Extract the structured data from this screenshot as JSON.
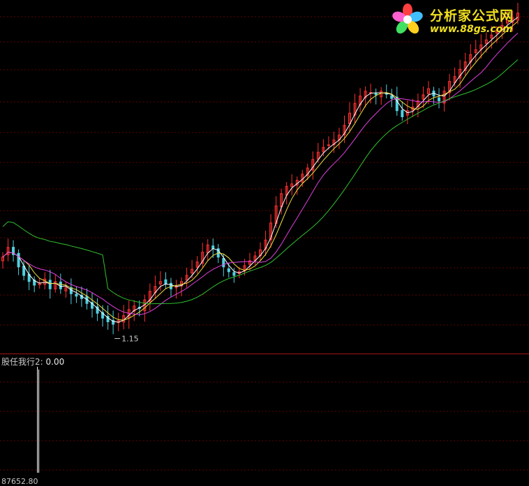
{
  "chart_data": [
    {
      "type": "candlestick",
      "panel": "main",
      "min_marker": "1.15",
      "grid": "horizontal dotted red lines",
      "colors": {
        "up": "#ff3030",
        "down": "#50d0e0",
        "ma_short": "#ffffff",
        "ma_mid": "#f0e040",
        "ma_long": "#e040e0",
        "ma_longest": "#30c030",
        "grid": "#600000",
        "background": "#000000"
      },
      "close_series": [
        1.7,
        1.78,
        1.72,
        1.62,
        1.55,
        1.5,
        1.47,
        1.49,
        1.52,
        1.44,
        1.5,
        1.44,
        1.45,
        1.4,
        1.38,
        1.36,
        1.32,
        1.28,
        1.24,
        1.2,
        1.17,
        1.15,
        1.18,
        1.22,
        1.27,
        1.3,
        1.28,
        1.35,
        1.42,
        1.46,
        1.5,
        1.48,
        1.44,
        1.46,
        1.5,
        1.55,
        1.6,
        1.66,
        1.74,
        1.8,
        1.77,
        1.7,
        1.62,
        1.58,
        1.55,
        1.58,
        1.63,
        1.67,
        1.71,
        1.76,
        1.84,
        1.98,
        2.12,
        2.22,
        2.28,
        2.3,
        2.33,
        2.38,
        2.43,
        2.5,
        2.56,
        2.6,
        2.62,
        2.66,
        2.7,
        2.78,
        2.88,
        2.96,
        3.02,
        3.06,
        3.05,
        3.03,
        3.06,
        3.04,
        3.0,
        2.9,
        2.85,
        2.9,
        2.93,
        2.98,
        3.03,
        3.08,
        3.02,
        2.98,
        3.06,
        3.14,
        3.18,
        3.24,
        3.3,
        3.36,
        3.4,
        3.44,
        3.48,
        3.52,
        3.56,
        3.6,
        3.64,
        3.66,
        3.7
      ]
    },
    {
      "type": "bar",
      "panel": "sub",
      "title_label": "股任我行2:",
      "title_value": "0.00",
      "bottom_value": "87652.80",
      "spike_index": 3,
      "spike_value": 1,
      "colors": {
        "bar": "#ffffff",
        "grid": "#600000"
      }
    }
  ],
  "logo": {
    "title": "分析家公式网",
    "url": "www.88gs.com",
    "colors": {
      "text": "#f0e020",
      "petals": [
        "#ff4040",
        "#40c0ff",
        "#ffd020",
        "#40e060",
        "#ff60d0"
      ],
      "center": "#ffffff"
    }
  }
}
